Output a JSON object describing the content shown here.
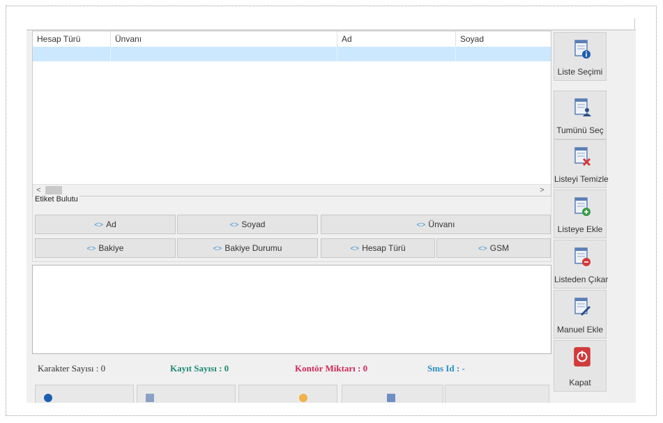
{
  "grid": {
    "columns": [
      "Hesap Türü",
      "Ünvanı",
      "Ad",
      "Soyad"
    ],
    "scroll_left_arrow": "<",
    "scroll_right_arrow": ">"
  },
  "tag_cloud": {
    "title": "Etiket Bulutu",
    "code_glyph": "<>",
    "buttons": [
      "Ad",
      "Soyad",
      "Ünvanı",
      "Bakiye",
      "Bakiye Durumu",
      "Hesap Türü",
      "GSM"
    ]
  },
  "status": {
    "char_count": "Karakter Sayısı : 0",
    "record_count": "Kayıt Sayısı : 0",
    "credit": "Kontör Miktarı : 0",
    "sms_id": "Sms Id : -"
  },
  "toolbar": {
    "list_select": "Liste Seçimi",
    "select_all": "Tumünü Seç",
    "clear_list": "Listeyi Temizle",
    "add_to_list": "Listeye Ekle",
    "remove_from_list": "Listeden Çıkar",
    "manual_add": "Manuel Ekle",
    "close": "Kapat"
  },
  "colors": {
    "selection": "#cce8ff",
    "record_count": "#1f8a74",
    "credit": "#d0285a",
    "sms_id": "#2a8fc9",
    "close_icon": "#d23a3a"
  },
  "icons": [
    "list-info-icon",
    "list-user-icon",
    "list-clear-icon",
    "list-add-icon",
    "list-remove-icon",
    "list-edit-icon",
    "power-icon"
  ]
}
